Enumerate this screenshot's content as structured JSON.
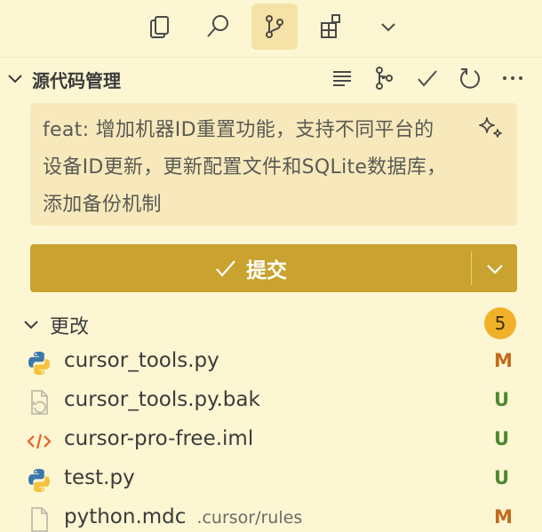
{
  "activity_bar": {
    "items": [
      {
        "icon": "explorer-icon",
        "active": false
      },
      {
        "icon": "search-icon",
        "active": false
      },
      {
        "icon": "source-control-icon",
        "active": true
      },
      {
        "icon": "extensions-icon",
        "active": false
      },
      {
        "icon": "chevron-down-icon",
        "active": false
      }
    ]
  },
  "header": {
    "title": "源代码管理",
    "actions": [
      "list-view-icon",
      "graph-icon",
      "checkmark-icon",
      "refresh-icon",
      "more-icon"
    ]
  },
  "commit": {
    "message": "feat: 增加机器ID重置功能，支持不同平台的设备ID更新，更新配置文件和SQLite数据库，添加备份机制",
    "button_label": "提交"
  },
  "changes": {
    "label": "更改",
    "count": "5",
    "files": [
      {
        "name": "cursor_tools.py",
        "path": "",
        "status": "M",
        "icon": "python-icon"
      },
      {
        "name": "cursor_tools.py.bak",
        "path": "",
        "status": "U",
        "icon": "backup-file-icon"
      },
      {
        "name": "cursor-pro-free.iml",
        "path": "",
        "status": "U",
        "icon": "code-file-icon"
      },
      {
        "name": "test.py",
        "path": "",
        "status": "U",
        "icon": "python-icon"
      },
      {
        "name": "python.mdc",
        "path": ".cursor/rules",
        "status": "M",
        "icon": "file-icon"
      }
    ]
  },
  "colors": {
    "background": "#FDF6D3",
    "accent": "#C9A22F",
    "badge": "#F0B129",
    "modified": "#C46A1A",
    "untracked": "#4C8A2F"
  }
}
